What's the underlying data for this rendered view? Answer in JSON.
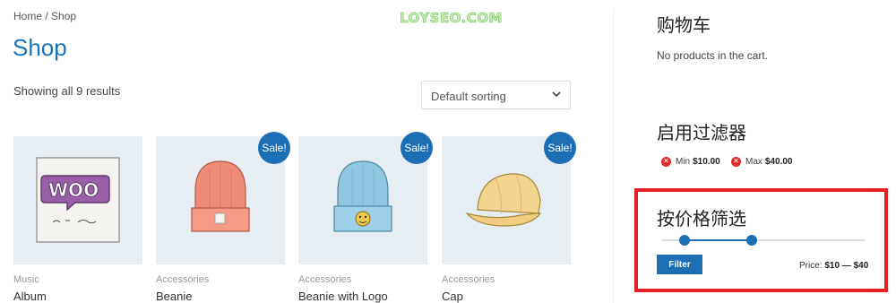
{
  "breadcrumb": "Home / Shop",
  "watermark": "LOYSEO.COM",
  "page_title": "Shop",
  "result_count": "Showing all 9 results",
  "sort": {
    "selected": "Default sorting"
  },
  "products": [
    {
      "category": "Music",
      "name": "Album",
      "sale": false,
      "image": "woo-album-icon"
    },
    {
      "category": "Accessories",
      "name": "Beanie",
      "sale": true,
      "sale_label": "Sale!",
      "image": "orange-beanie-icon"
    },
    {
      "category": "Accessories",
      "name": "Beanie with Logo",
      "sale": true,
      "sale_label": "Sale!",
      "image": "blue-beanie-icon"
    },
    {
      "category": "Accessories",
      "name": "Cap",
      "sale": true,
      "sale_label": "Sale!",
      "image": "yellow-cap-icon"
    }
  ],
  "sidebar": {
    "cart_title": "购物车",
    "cart_empty": "No products in the cart.",
    "active_filters_title": "启用过滤器",
    "filters": [
      {
        "label": "Min",
        "value": "$10.00"
      },
      {
        "label": "Max",
        "value": "$40.00"
      }
    ],
    "price_filter_title": "按价格筛选",
    "filter_button": "Filter",
    "price_label": "Price:",
    "price_range": "$10 — $40"
  },
  "colors": {
    "accent": "#1c6fb5",
    "link": "#1a74bd",
    "highlight_border": "#e41f26",
    "image_bg": "#e7eef3"
  }
}
